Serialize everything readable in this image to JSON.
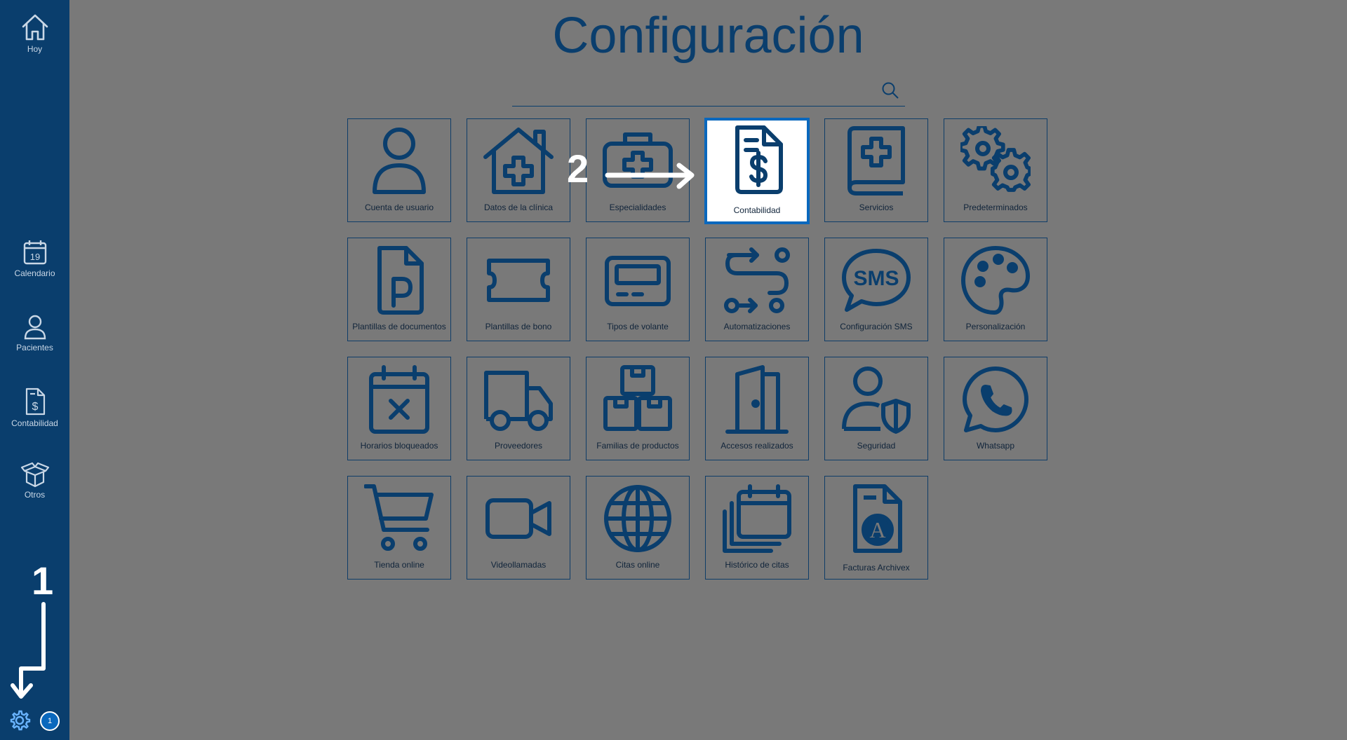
{
  "sidebar": {
    "items": [
      {
        "label": "Hoy",
        "icon": "home-icon"
      },
      {
        "label": "Calendario",
        "icon": "calendar-icon",
        "day": "19"
      },
      {
        "label": "Pacientes",
        "icon": "person-icon"
      },
      {
        "label": "Contabilidad",
        "icon": "invoice-dollar-icon"
      },
      {
        "label": "Otros",
        "icon": "open-box-icon"
      }
    ],
    "settings_icon": "gear-icon",
    "notification_count": "1"
  },
  "header": {
    "title": "Configuración"
  },
  "search": {
    "placeholder": "",
    "icon": "search-icon"
  },
  "tiles": [
    {
      "label": "Cuenta de usuario",
      "icon": "user-icon"
    },
    {
      "label": "Datos de la clínica",
      "icon": "clinic-house-icon"
    },
    {
      "label": "Especialidades",
      "icon": "medical-kit-icon"
    },
    {
      "label": "Contabilidad",
      "icon": "invoice-dollar-icon",
      "selected": true
    },
    {
      "label": "Servicios",
      "icon": "medical-book-icon"
    },
    {
      "label": "Predeterminados",
      "icon": "gears-icon"
    },
    {
      "label": "Plantillas de documentos",
      "icon": "document-p-icon"
    },
    {
      "label": "Plantillas de bono",
      "icon": "ticket-icon"
    },
    {
      "label": "Tipos de volante",
      "icon": "pager-icon"
    },
    {
      "label": "Automatizaciones",
      "icon": "route-icon"
    },
    {
      "label": "Configuración SMS",
      "icon": "sms-bubble-icon"
    },
    {
      "label": "Personalización",
      "icon": "palette-icon"
    },
    {
      "label": "Horarios bloqueados",
      "icon": "calendar-x-icon"
    },
    {
      "label": "Proveedores",
      "icon": "truck-icon"
    },
    {
      "label": "Familias de productos",
      "icon": "boxes-icon"
    },
    {
      "label": "Accesos realizados",
      "icon": "door-icon"
    },
    {
      "label": "Seguridad",
      "icon": "user-shield-icon"
    },
    {
      "label": "Whatsapp",
      "icon": "whatsapp-icon"
    },
    {
      "label": "Tienda online",
      "icon": "shopping-cart-icon"
    },
    {
      "label": "Videollamadas",
      "icon": "video-camera-icon"
    },
    {
      "label": "Citas online",
      "icon": "globe-icon"
    },
    {
      "label": "Histórico de citas",
      "icon": "calendar-stack-icon"
    },
    {
      "label": "Facturas Archivex",
      "icon": "document-a-icon"
    }
  ],
  "annotations": {
    "step1": "1",
    "step2": "2"
  },
  "colors": {
    "sidebar": "#0a3e6d",
    "background": "#797979",
    "accent": "#0a68bd",
    "icon": "#0a3e6d"
  }
}
